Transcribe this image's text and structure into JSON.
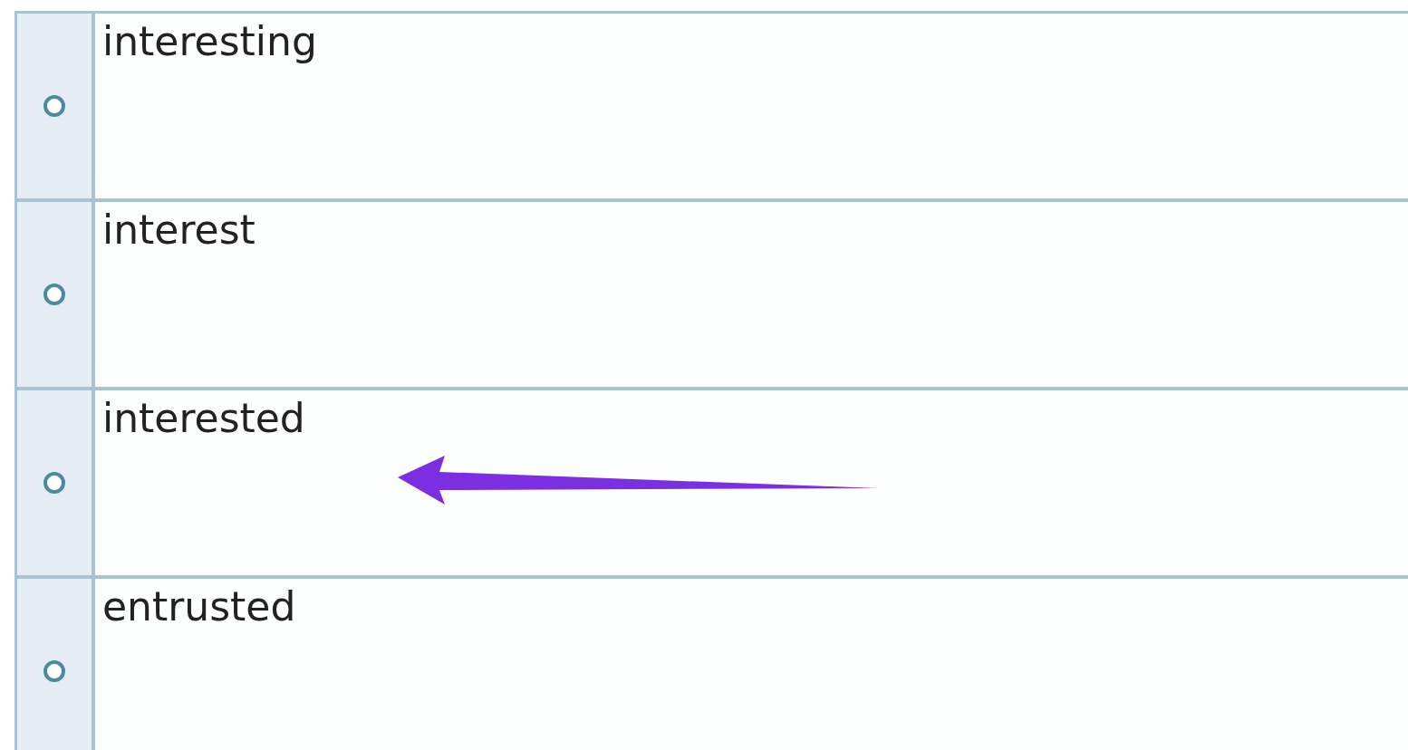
{
  "options": [
    {
      "label": "interesting",
      "selected": false,
      "marked": false
    },
    {
      "label": "interest",
      "selected": false,
      "marked": false
    },
    {
      "label": "interested",
      "selected": false,
      "marked": true
    },
    {
      "label": "entrusted",
      "selected": false,
      "marked": false
    }
  ]
}
